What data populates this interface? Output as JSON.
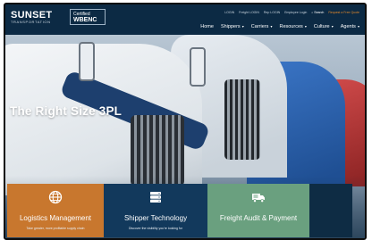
{
  "header": {
    "brand": "SUNSET",
    "brand_sub": "TRANSPORTATION",
    "partner_badge": {
      "top": "Certified",
      "big": "WBENC"
    },
    "utility_links": [
      "LOGIN",
      "Freight LOGIN",
      "Rep LOGIN",
      "Employee Login"
    ],
    "search_label": "Search",
    "request_quote": "Request a Free Quote"
  },
  "nav": {
    "items": [
      {
        "label": "Home",
        "has_menu": false
      },
      {
        "label": "Shippers",
        "has_menu": true
      },
      {
        "label": "Carriers",
        "has_menu": true
      },
      {
        "label": "Resources",
        "has_menu": true
      },
      {
        "label": "Culture",
        "has_menu": true
      },
      {
        "label": "Agents",
        "has_menu": true
      }
    ]
  },
  "hero": {
    "headline": "The Right Size 3PL"
  },
  "cards": [
    {
      "title": "Logistics Management",
      "icon": "globe-icon",
      "color": "#c8772e",
      "desc": "Take greater, more profitable supply chain"
    },
    {
      "title": "Shipper Technology",
      "icon": "server-icon",
      "color": "#12395c",
      "desc": "Discover the visibility you're looking for"
    },
    {
      "title": "Freight Audit & Payment",
      "icon": "truck-icon",
      "color": "#6aa07f",
      "desc": ""
    }
  ],
  "colors": {
    "navy": "#0c2a44",
    "orange": "#c8772e",
    "green": "#6aa07f",
    "accent_link": "#e58a2c"
  }
}
